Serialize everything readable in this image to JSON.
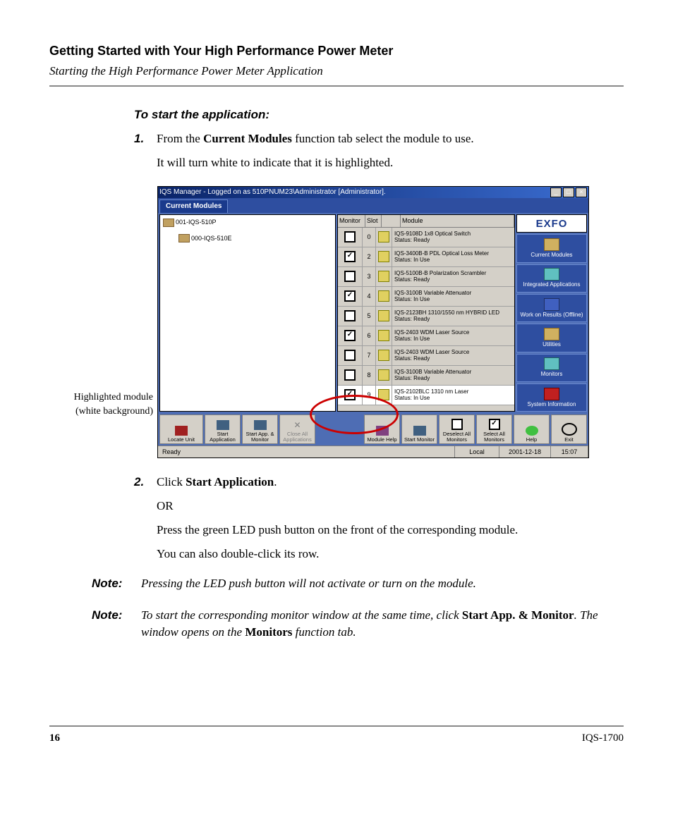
{
  "header": {
    "title": "Getting Started with Your High Performance Power Meter",
    "subtitle": "Starting the High Performance Power Meter Application"
  },
  "instr_title": "To start the application:",
  "step1": {
    "num": "1.",
    "pre": "From the ",
    "bold": "Current Modules",
    "post": " function tab select the module to use.",
    "para2": "It will turn white to indicate that it is highlighted."
  },
  "callout": {
    "line1": "Highlighted module",
    "line2": "(white background)"
  },
  "app": {
    "title": "IQS Manager - Logged on as 510PNUM23\\Administrator [Administrator].",
    "tab": "Current Modules",
    "logo": "EXFO",
    "tree": {
      "root": "001-IQS-510P",
      "child": "000-IQS-510E"
    },
    "grid_head": {
      "monitor": "Monitor",
      "slot": "Slot",
      "module": "Module"
    },
    "rows": [
      {
        "chk": false,
        "slot": "0",
        "name": "IQS-9108D 1x8 Optical Switch",
        "status": "Status:  Ready",
        "hl": false
      },
      {
        "chk": true,
        "slot": "2",
        "name": "IQS-3400B-B PDL Optical Loss Meter",
        "status": "Status:  In Use",
        "hl": false
      },
      {
        "chk": false,
        "slot": "3",
        "name": "IQS-5100B-B Polarization Scrambler",
        "status": "Status:  Ready",
        "hl": false
      },
      {
        "chk": true,
        "slot": "4",
        "name": "IQS-3100B Variable Attenuator",
        "status": "Status:  In Use",
        "hl": false
      },
      {
        "chk": false,
        "slot": "5",
        "name": "IQS-2123BH 1310/1550 nm HYBRID LED",
        "status": "Status:  Ready",
        "hl": false
      },
      {
        "chk": true,
        "slot": "6",
        "name": "IQS-2403 WDM Laser Source",
        "status": "Status:  In Use",
        "hl": false
      },
      {
        "chk": false,
        "slot": "7",
        "name": "IQS-2403 WDM Laser Source",
        "status": "Status:  Ready",
        "hl": false
      },
      {
        "chk": false,
        "slot": "8",
        "name": "IQS-3100B Variable Attenuator",
        "status": "Status:  Ready",
        "hl": false
      },
      {
        "chk": true,
        "slot": "9",
        "name": "IQS-2102BLC 1310 nm Laser",
        "status": "Status:  In Use",
        "hl": true
      }
    ],
    "nav": [
      "Current Modules",
      "Integrated Applications",
      "Work on Results (Offline)",
      "Utilities",
      "Monitors",
      "System Information"
    ],
    "toolbar": {
      "locate": "Locate Unit",
      "start_app": "Start Application",
      "start_app_mon": "Start App. & Monitor",
      "close_all": "Close All Applications",
      "mod_help": "Module Help",
      "start_mon": "Start Monitor",
      "deselect": "Deselect All Monitors",
      "select": "Select All Monitors",
      "help": "Help",
      "exit": "Exit"
    },
    "status": {
      "ready": "Ready",
      "local": "Local",
      "date": "2001-12-18",
      "time": "15:07"
    }
  },
  "step2": {
    "num": "2.",
    "pre": "Click ",
    "bold": "Start Application",
    "post": ".",
    "or": "OR",
    "p2": "Press the green LED push button on the front of the corresponding module.",
    "p3": "You can also double-click its row."
  },
  "note1": {
    "label": "Note:",
    "text": "Pressing the LED push button will not activate or turn on the module."
  },
  "note2": {
    "label": "Note:",
    "pre": "To start the corresponding monitor window at the same time, click ",
    "b1": "Start App. & Monitor",
    "mid": ". The window opens on the ",
    "b2": "Monitors",
    "post": " function tab."
  },
  "footer": {
    "page": "16",
    "doc": "IQS-1700"
  }
}
